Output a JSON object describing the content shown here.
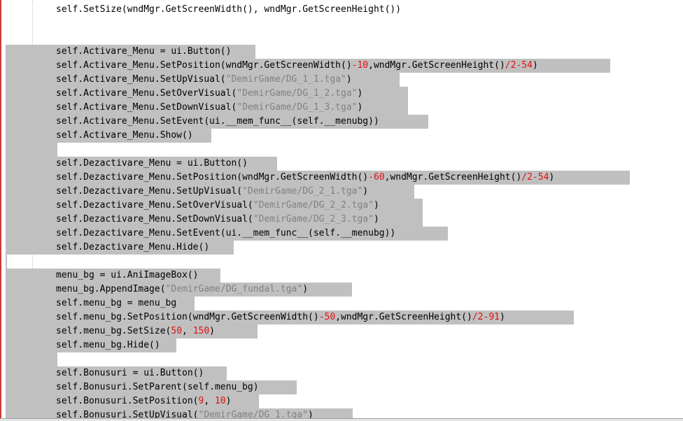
{
  "editor": {
    "lines": [
      {
        "sel": false,
        "selw": 0,
        "parts": [
          [
            "t",
            "self.SetSize(wndMgr.GetScreenWidth(), wndMgr.GetScreenHeight())"
          ]
        ]
      },
      {
        "sel": false,
        "selw": 0,
        "parts": []
      },
      {
        "sel": false,
        "selw": 0,
        "parts": []
      },
      {
        "sel": true,
        "selw": 365,
        "parts": [
          [
            "t",
            "self.Activare_Menu = ui.Button()"
          ]
        ]
      },
      {
        "sel": true,
        "selw": 872,
        "parts": [
          [
            "t",
            "self.Activare_Menu.SetPosition(wndMgr.GetScreenWidth()"
          ],
          [
            "n",
            "-10"
          ],
          [
            "t",
            ",wndMgr.GetScreenHeight()"
          ],
          [
            "n",
            "/2-54"
          ],
          [
            "t",
            ")"
          ]
        ]
      },
      {
        "sel": true,
        "selw": 571,
        "parts": [
          [
            "t",
            "self.Activare_Menu.SetUpVisual("
          ],
          [
            "s",
            "\"DemirGame/DG_1_1.tga\""
          ],
          [
            "t",
            ")"
          ]
        ]
      },
      {
        "sel": true,
        "selw": 583,
        "parts": [
          [
            "t",
            "self.Activare_Menu.SetOverVisual("
          ],
          [
            "s",
            "\"DemirGame/DG_1_2.tga\""
          ],
          [
            "t",
            ")"
          ]
        ]
      },
      {
        "sel": true,
        "selw": 583,
        "parts": [
          [
            "t",
            "self.Activare_Menu.SetDownVisual("
          ],
          [
            "s",
            "\"DemirGame/DG_1_3.tga\""
          ],
          [
            "t",
            ")"
          ]
        ]
      },
      {
        "sel": true,
        "selw": 612,
        "parts": [
          [
            "t",
            "self.Activare_Menu.SetEvent(ui.__mem_func__(self.__menubg))"
          ]
        ]
      },
      {
        "sel": true,
        "selw": 302,
        "parts": [
          [
            "t",
            "self.Activare_Menu.Show()"
          ]
        ]
      },
      {
        "sel": true,
        "selw": 82,
        "parts": []
      },
      {
        "sel": true,
        "selw": 396,
        "parts": [
          [
            "t",
            "self.Dezactivare_Menu = ui.Button()"
          ]
        ]
      },
      {
        "sel": true,
        "selw": 900,
        "parts": [
          [
            "t",
            "self.Dezactivare_Menu.SetPosition(wndMgr.GetScreenWidth()"
          ],
          [
            "n",
            "-60"
          ],
          [
            "t",
            ",wndMgr.GetScreenHeight()"
          ],
          [
            "n",
            "/2-54"
          ],
          [
            "t",
            ")"
          ]
        ]
      },
      {
        "sel": true,
        "selw": 592,
        "parts": [
          [
            "t",
            "self.Dezactivare_Menu.SetUpVisual("
          ],
          [
            "s",
            "\"DemirGame/DG_2_1.tga\""
          ],
          [
            "t",
            ")"
          ]
        ]
      },
      {
        "sel": true,
        "selw": 604,
        "parts": [
          [
            "t",
            "self.Dezactivare_Menu.SetOverVisual("
          ],
          [
            "s",
            "\"DemirGame/DG_2_2.tga\""
          ],
          [
            "t",
            ")"
          ]
        ]
      },
      {
        "sel": true,
        "selw": 604,
        "parts": [
          [
            "t",
            "self.Dezactivare_Menu.SetDownVisual("
          ],
          [
            "s",
            "\"DemirGame/DG_2_3.tga\""
          ],
          [
            "t",
            ")"
          ]
        ]
      },
      {
        "sel": true,
        "selw": 640,
        "parts": [
          [
            "t",
            "self.Dezactivare_Menu.SetEvent(ui.__mem_func__(self.__menubg))"
          ]
        ]
      },
      {
        "sel": true,
        "selw": 334,
        "parts": [
          [
            "t",
            "self.Dezactivare_Menu.Hide()"
          ]
        ]
      },
      {
        "sel": true,
        "selw": 10,
        "parts": []
      },
      {
        "sel": true,
        "selw": 315,
        "parts": [
          [
            "t",
            "menu_bg = ui.AniImageBox()"
          ]
        ]
      },
      {
        "sel": true,
        "selw": 503,
        "parts": [
          [
            "t",
            "menu_bg.AppendImage("
          ],
          [
            "s",
            "\"DemirGame/DG_fundal.tga\""
          ],
          [
            "t",
            ")"
          ]
        ]
      },
      {
        "sel": true,
        "selw": 278,
        "parts": [
          [
            "t",
            "self.menu_bg = menu_bg"
          ]
        ]
      },
      {
        "sel": true,
        "selw": 820,
        "parts": [
          [
            "t",
            "self.menu_bg.SetPosition(wndMgr.GetScreenWidth()"
          ],
          [
            "n",
            "-50"
          ],
          [
            "t",
            ",wndMgr.GetScreenHeight()"
          ],
          [
            "n",
            "/2-91"
          ],
          [
            "t",
            ")"
          ]
        ]
      },
      {
        "sel": true,
        "selw": 368,
        "parts": [
          [
            "t",
            "self.menu_bg.SetSize("
          ],
          [
            "n",
            "50"
          ],
          [
            "t",
            ", "
          ],
          [
            "n",
            "150"
          ],
          [
            "t",
            ")"
          ]
        ]
      },
      {
        "sel": true,
        "selw": 252,
        "parts": [
          [
            "t",
            "self.menu_bg.Hide()"
          ]
        ]
      },
      {
        "sel": true,
        "selw": 82,
        "parts": []
      },
      {
        "sel": true,
        "selw": 324,
        "parts": [
          [
            "t",
            "self.Bonusuri = ui.Button()"
          ]
        ]
      },
      {
        "sel": true,
        "selw": 424,
        "parts": [
          [
            "t",
            "self.Bonusuri.SetParent(self.menu_bg)"
          ]
        ]
      },
      {
        "sel": true,
        "selw": 370,
        "parts": [
          [
            "t",
            "self.Bonusuri.SetPosition("
          ],
          [
            "n",
            "9"
          ],
          [
            "t",
            ", "
          ],
          [
            "n",
            "10"
          ],
          [
            "t",
            ")"
          ]
        ]
      },
      {
        "sel": true,
        "selw": 504,
        "parts": [
          [
            "t",
            "self.Bonusuri.SetUpVisual("
          ],
          [
            "s",
            "\"DemirGame/DG_1.tga\""
          ],
          [
            "t",
            ")"
          ]
        ]
      }
    ]
  }
}
